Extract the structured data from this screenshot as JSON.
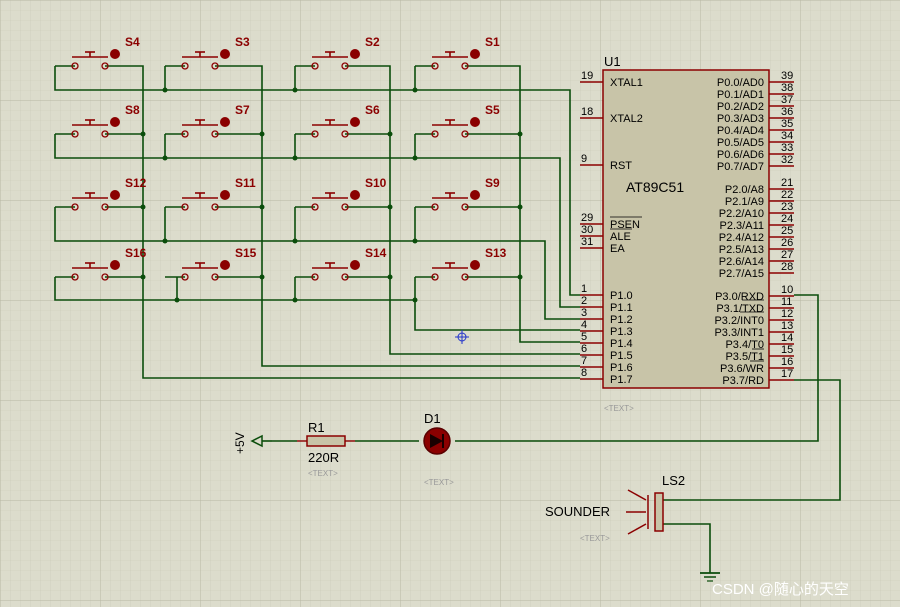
{
  "chip": {
    "ref": "U1",
    "name": "AT89C51",
    "placeholder": "<TEXT>",
    "left_pins": [
      {
        "num": "19",
        "name": "XTAL1"
      },
      {
        "num": "18",
        "name": "XTAL2"
      },
      {
        "num": "9",
        "name": "RST"
      },
      {
        "num": "29",
        "name": "PSEN"
      },
      {
        "num": "30",
        "name": "ALE"
      },
      {
        "num": "31",
        "name": "EA"
      },
      {
        "num": "1",
        "name": "P1.0"
      },
      {
        "num": "2",
        "name": "P1.1"
      },
      {
        "num": "3",
        "name": "P1.2"
      },
      {
        "num": "4",
        "name": "P1.3"
      },
      {
        "num": "5",
        "name": "P1.4"
      },
      {
        "num": "6",
        "name": "P1.5"
      },
      {
        "num": "7",
        "name": "P1.6"
      },
      {
        "num": "8",
        "name": "P1.7"
      }
    ],
    "right_pins": [
      {
        "num": "39",
        "name": "P0.0/AD0"
      },
      {
        "num": "38",
        "name": "P0.1/AD1"
      },
      {
        "num": "37",
        "name": "P0.2/AD2"
      },
      {
        "num": "36",
        "name": "P0.3/AD3"
      },
      {
        "num": "35",
        "name": "P0.4/AD4"
      },
      {
        "num": "34",
        "name": "P0.5/AD5"
      },
      {
        "num": "33",
        "name": "P0.6/AD6"
      },
      {
        "num": "32",
        "name": "P0.7/AD7"
      },
      {
        "num": "21",
        "name": "P2.0/A8"
      },
      {
        "num": "22",
        "name": "P2.1/A9"
      },
      {
        "num": "23",
        "name": "P2.2/A10"
      },
      {
        "num": "24",
        "name": "P2.3/A11"
      },
      {
        "num": "25",
        "name": "P2.4/A12"
      },
      {
        "num": "26",
        "name": "P2.5/A13"
      },
      {
        "num": "27",
        "name": "P2.6/A14"
      },
      {
        "num": "28",
        "name": "P2.7/A15"
      },
      {
        "num": "10",
        "name": "P3.0/RXD"
      },
      {
        "num": "11",
        "name": "P3.1/TXD"
      },
      {
        "num": "12",
        "name": "P3.2/INT0"
      },
      {
        "num": "13",
        "name": "P3.3/INT1"
      },
      {
        "num": "14",
        "name": "P3.4/T0"
      },
      {
        "num": "15",
        "name": "P3.5/T1"
      },
      {
        "num": "16",
        "name": "P3.6/WR"
      },
      {
        "num": "17",
        "name": "P3.7/RD"
      }
    ]
  },
  "switches": [
    [
      "S4",
      "S3",
      "S2",
      "S1"
    ],
    [
      "S8",
      "S7",
      "S6",
      "S5"
    ],
    [
      "S12",
      "S11",
      "S10",
      "S9"
    ],
    [
      "S16",
      "S15",
      "S14",
      "S13"
    ]
  ],
  "power": {
    "label": "+5V"
  },
  "resistor": {
    "ref": "R1",
    "value": "220R",
    "placeholder": "<TEXT>"
  },
  "diode": {
    "ref": "D1",
    "placeholder": "<TEXT>"
  },
  "sounder": {
    "ref": "LS2",
    "name": "SOUNDER",
    "placeholder": "<TEXT>"
  },
  "watermark": "CSDN @随心的天空",
  "colors": {
    "background": "#dcdccc",
    "grid": "#c6c6b4",
    "wire": "#0b4d0b",
    "component": "#8b0000",
    "chip_fill": "#c8c4a8"
  }
}
